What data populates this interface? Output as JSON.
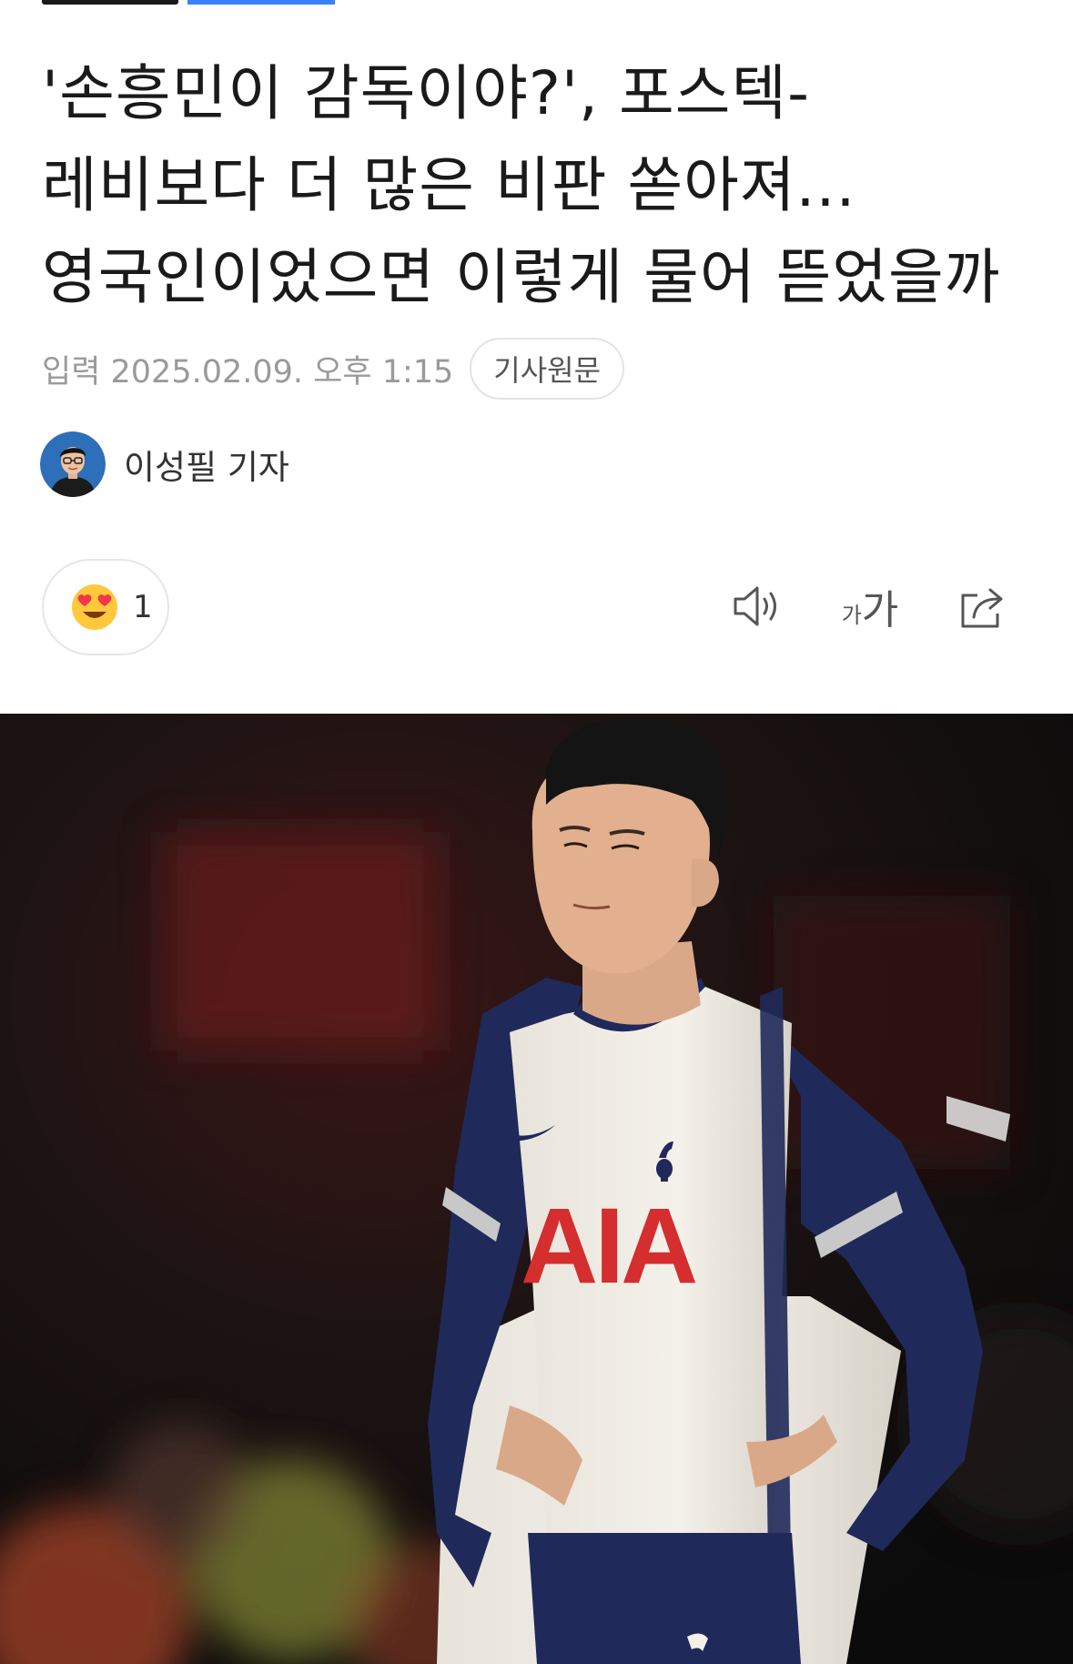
{
  "article": {
    "title": "'손흥민이 감독이야?', 포스텍-레비보다 더 많은 비판 쏟아져...영국인이었으면 이렇게 물어 뜯었을까",
    "date": "입력 2025.02.09. 오후 1:15",
    "original_button": "기사원문",
    "author": "이성필 기자"
  },
  "reaction": {
    "icon": "heart-eyes-emoji-icon",
    "count": "1"
  },
  "toolbar": {
    "speaker_icon": "speaker-icon",
    "font_small": "가",
    "font_large": "가",
    "share_icon": "share-icon"
  },
  "photo": {
    "jersey_sponsor": "AIA"
  },
  "colors": {
    "accent": "#3b82f6",
    "jersey_navy": "#1f2a5a",
    "sponsor_red": "#d42e2e"
  }
}
